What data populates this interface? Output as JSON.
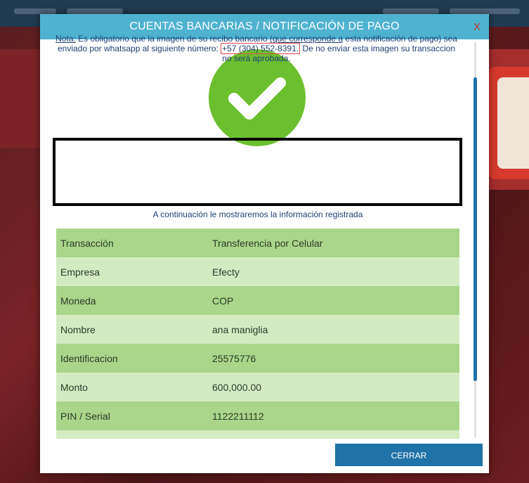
{
  "modal": {
    "title": "CUENTAS BANCARIAS / NOTIFICACIÓN DE PAGO",
    "close_label": "X",
    "note": {
      "label": "Nota:",
      "text_part1": " Es obligatorio que la imagen de su recibo bancario ",
      "underlined": "(que corresponde a",
      "text_part2": " esta notificación de pago) sea enviado por whatsapp al siguiente número: ",
      "phone": "+57 (304) 552-8391.",
      "text_part3": " De no enviar esta imagen su transaccion no será aprobada."
    },
    "subtitle": "A continuación le mostraremos la información registrada",
    "rows": [
      {
        "label": "Transacción",
        "value": "Transferencia por Celular"
      },
      {
        "label": "Empresa",
        "value": "Efecty"
      },
      {
        "label": "Moneda",
        "value": "COP"
      },
      {
        "label": "Nombre",
        "value": "ana maniglia"
      },
      {
        "label": "Identificacion",
        "value": "25575776"
      },
      {
        "label": "Monto",
        "value": "600,000.00"
      },
      {
        "label": "PIN / Serial",
        "value": "1122211112"
      }
    ],
    "close_button": "CERRAR"
  },
  "colors": {
    "header": "#4fb3d0",
    "success": "#6cbf2e",
    "row_dark": "#a9d68a",
    "row_light": "#d4ebc2",
    "button": "#1f73a8",
    "close_x": "#c0392b"
  },
  "icons": {
    "success": "check-icon"
  }
}
